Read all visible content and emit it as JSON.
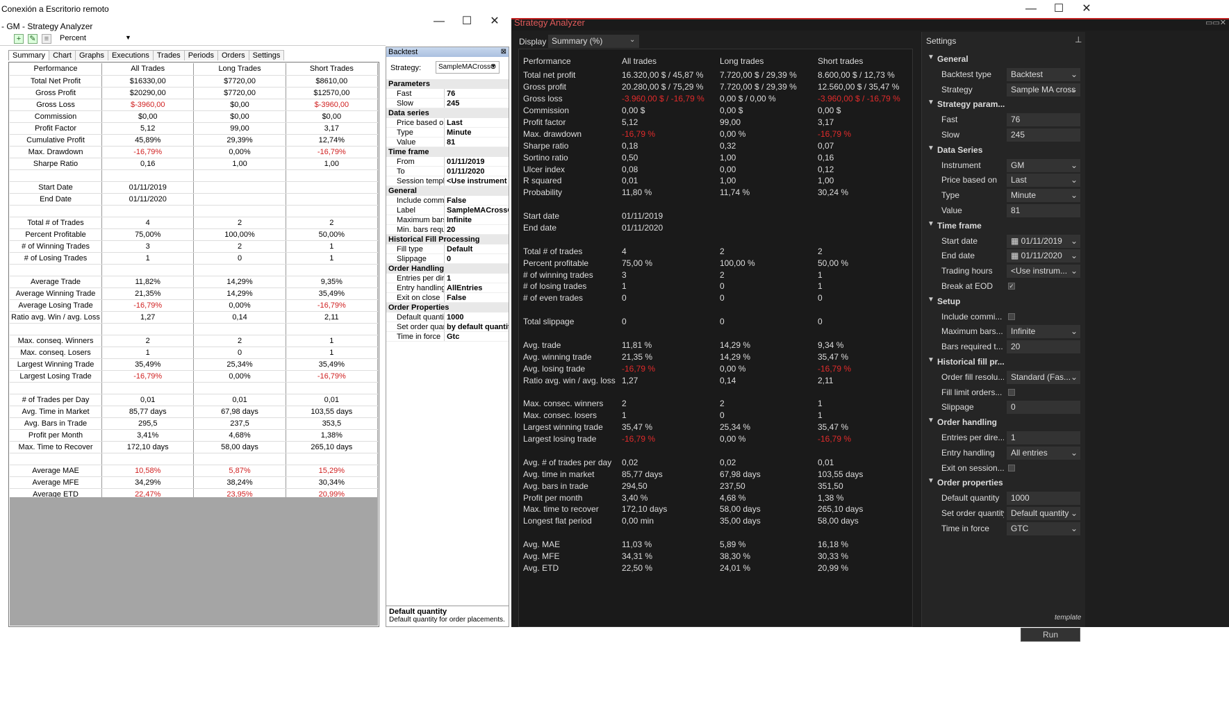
{
  "rd": {
    "title": "Conexión a Escritorio remoto",
    "old_title": "- GM - Strategy Analyzer",
    "min": "—",
    "max": "☐",
    "close": "✕"
  },
  "toolbar": {
    "mode": "Percent"
  },
  "tabs": [
    "Summary",
    "Chart",
    "Graphs",
    "Executions",
    "Trades",
    "Periods",
    "Orders",
    "Settings"
  ],
  "left_table": [
    [
      "Performance",
      "All Trades",
      "Long Trades",
      "Short Trades"
    ],
    [
      "Total Net Profit",
      "$16330,00",
      "$7720,00",
      "$8610,00"
    ],
    [
      "Gross Profit",
      "$20290,00",
      "$7720,00",
      "$12570,00"
    ],
    [
      "Gross Loss",
      "$-3960,00",
      "$0,00",
      "$-3960,00"
    ],
    [
      "Commission",
      "$0,00",
      "$0,00",
      "$0,00"
    ],
    [
      "Profit Factor",
      "5,12",
      "99,00",
      "3,17"
    ],
    [
      "Cumulative Profit",
      "45,89%",
      "29,39%",
      "12,74%"
    ],
    [
      "Max. Drawdown",
      "-16,79%",
      "0,00%",
      "-16,79%"
    ],
    [
      "Sharpe Ratio",
      "0,16",
      "1,00",
      "1,00"
    ],
    [
      "",
      "",
      "",
      ""
    ],
    [
      "Start Date",
      "01/11/2019",
      "",
      ""
    ],
    [
      "End Date",
      "01/11/2020",
      "",
      ""
    ],
    [
      "",
      "",
      "",
      ""
    ],
    [
      "Total # of Trades",
      "4",
      "2",
      "2"
    ],
    [
      "Percent Profitable",
      "75,00%",
      "100,00%",
      "50,00%"
    ],
    [
      "# of Winning Trades",
      "3",
      "2",
      "1"
    ],
    [
      "# of Losing Trades",
      "1",
      "0",
      "1"
    ],
    [
      "",
      "",
      "",
      ""
    ],
    [
      "Average Trade",
      "11,82%",
      "14,29%",
      "9,35%"
    ],
    [
      "Average Winning Trade",
      "21,35%",
      "14,29%",
      "35,49%"
    ],
    [
      "Average Losing Trade",
      "-16,79%",
      "0,00%",
      "-16,79%"
    ],
    [
      "Ratio avg. Win / avg. Loss",
      "1,27",
      "0,14",
      "2,11"
    ],
    [
      "",
      "",
      "",
      ""
    ],
    [
      "Max. conseq. Winners",
      "2",
      "2",
      "1"
    ],
    [
      "Max. conseq. Losers",
      "1",
      "0",
      "1"
    ],
    [
      "Largest Winning Trade",
      "35,49%",
      "25,34%",
      "35,49%"
    ],
    [
      "Largest Losing Trade",
      "-16,79%",
      "0,00%",
      "-16,79%"
    ],
    [
      "",
      "",
      "",
      ""
    ],
    [
      "# of Trades per Day",
      "0,01",
      "0,01",
      "0,01"
    ],
    [
      "Avg. Time in Market",
      "85,77 days",
      "67,98 days",
      "103,55 days"
    ],
    [
      "Avg. Bars in Trade",
      "295,5",
      "237,5",
      "353,5"
    ],
    [
      "Profit per Month",
      "3,41%",
      "4,68%",
      "1,38%"
    ],
    [
      "Max. Time to Recover",
      "172,10 days",
      "58,00 days",
      "265,10 days"
    ],
    [
      "",
      "",
      "",
      ""
    ],
    [
      "Average MAE",
      "10,58%",
      "5,87%",
      "15,29%"
    ],
    [
      "Average MFE",
      "34,29%",
      "38,24%",
      "30,34%"
    ],
    [
      "Average ETD",
      "22,47%",
      "23,95%",
      "20,99%"
    ]
  ],
  "backtest": {
    "title": "Backtest",
    "strategy_label": "Strategy:",
    "strategy": "SampleMACrossO",
    "sections": [
      {
        "name": "Parameters",
        "rows": [
          [
            "Fast",
            "76"
          ],
          [
            "Slow",
            "245"
          ]
        ]
      },
      {
        "name": "Data series",
        "rows": [
          [
            "Price based on",
            "Last"
          ],
          [
            "Type",
            "Minute"
          ],
          [
            "Value",
            "81"
          ]
        ]
      },
      {
        "name": "Time frame",
        "rows": [
          [
            "From",
            "01/11/2019"
          ],
          [
            "To",
            "01/11/2020"
          ],
          [
            "Session templa",
            "<Use instrument se"
          ]
        ]
      },
      {
        "name": "General",
        "rows": [
          [
            "Include commis",
            "False"
          ],
          [
            "Label",
            "SampleMACrossOv"
          ],
          [
            "Maximum bars",
            "Infinite"
          ],
          [
            "Min. bars requi",
            "20"
          ]
        ]
      },
      {
        "name": "Historical Fill Processing",
        "rows": [
          [
            "Fill type",
            "Default"
          ],
          [
            "Slippage",
            "0"
          ]
        ]
      },
      {
        "name": "Order Handling",
        "rows": [
          [
            "Entries per dire",
            "1"
          ],
          [
            "Entry handling",
            "AllEntries"
          ],
          [
            "Exit on close",
            "False"
          ]
        ]
      },
      {
        "name": "Order Properties",
        "rows": [
          [
            "Default quantity",
            "1000"
          ],
          [
            "Set order quant",
            "by default quantity"
          ],
          [
            "Time in force",
            "Gtc"
          ]
        ]
      }
    ],
    "help_title": "Default quantity",
    "help_text": "Default quantity for order placements."
  },
  "dark": {
    "title": "Strategy Analyzer",
    "display_label": "Display",
    "display_value": "Summary (%)",
    "headers": [
      "Performance",
      "All trades",
      "Long trades",
      "Short trades"
    ],
    "rows": [
      [
        "Total net profit",
        "16.320,00 $ / 45,87 %",
        "7.720,00 $ / 29,39 %",
        "8.600,00 $ / 12,73 %"
      ],
      [
        "Gross profit",
        "20.280,00 $ / 75,29 %",
        "7.720,00 $ / 29,39 %",
        "12.560,00 $ / 35,47 %"
      ],
      [
        "Gross loss",
        "-3.960,00 $ / -16,79 %",
        "0,00 $ / 0,00 %",
        "-3.960,00 $ / -16,79 %"
      ],
      [
        "Commission",
        "0,00 $",
        "0,00 $",
        "0,00 $"
      ],
      [
        "Profit factor",
        "5,12",
        "99,00",
        "3,17"
      ],
      [
        "Max. drawdown",
        "-16,79 %",
        "0,00 %",
        "-16,79 %"
      ],
      [
        "Sharpe ratio",
        "0,18",
        "0,32",
        "0,07"
      ],
      [
        "Sortino ratio",
        "0,50",
        "1,00",
        "0,16"
      ],
      [
        "Ulcer index",
        "0,08",
        "0,00",
        "0,12"
      ],
      [
        "R squared",
        "0,01",
        "1,00",
        "1,00"
      ],
      [
        "Probability",
        "11,80 %",
        "11,74 %",
        "30,24 %"
      ],
      [
        "",
        "",
        "",
        ""
      ],
      [
        "Start date",
        "01/11/2019",
        "",
        ""
      ],
      [
        "End date",
        "01/11/2020",
        "",
        ""
      ],
      [
        "",
        "",
        "",
        ""
      ],
      [
        "Total # of trades",
        "4",
        "2",
        "2"
      ],
      [
        "Percent profitable",
        "75,00 %",
        "100,00 %",
        "50,00 %"
      ],
      [
        "# of winning trades",
        "3",
        "2",
        "1"
      ],
      [
        "# of losing trades",
        "1",
        "0",
        "1"
      ],
      [
        "# of even trades",
        "0",
        "0",
        "0"
      ],
      [
        "",
        "",
        "",
        ""
      ],
      [
        "Total slippage",
        "0",
        "0",
        "0"
      ],
      [
        "",
        "",
        "",
        ""
      ],
      [
        "Avg. trade",
        "11,81 %",
        "14,29 %",
        "9,34 %"
      ],
      [
        "Avg. winning trade",
        "21,35 %",
        "14,29 %",
        "35,47 %"
      ],
      [
        "Avg. losing trade",
        "-16,79 %",
        "0,00 %",
        "-16,79 %"
      ],
      [
        "Ratio avg. win / avg. loss",
        "1,27",
        "0,14",
        "2,11"
      ],
      [
        "",
        "",
        "",
        ""
      ],
      [
        "Max. consec. winners",
        "2",
        "2",
        "1"
      ],
      [
        "Max. consec. losers",
        "1",
        "0",
        "1"
      ],
      [
        "Largest winning trade",
        "35,47 %",
        "25,34 %",
        "35,47 %"
      ],
      [
        "Largest losing trade",
        "-16,79 %",
        "0,00 %",
        "-16,79 %"
      ],
      [
        "",
        "",
        "",
        ""
      ],
      [
        "Avg. # of trades per day",
        "0,02",
        "0,02",
        "0,01"
      ],
      [
        "Avg. time in market",
        "85,77 days",
        "67,98 days",
        "103,55 days"
      ],
      [
        "Avg. bars in trade",
        "294,50",
        "237,50",
        "351,50"
      ],
      [
        "Profit per month",
        "3,40 %",
        "4,68 %",
        "1,38 %"
      ],
      [
        "Max. time to recover",
        "172,10 days",
        "58,00 days",
        "265,10 days"
      ],
      [
        "Longest flat period",
        "0,00 min",
        "35,00 days",
        "58,00 days"
      ],
      [
        "",
        "",
        "",
        ""
      ],
      [
        "Avg. MAE",
        "11,03 %",
        "5,89 %",
        "16,18 %"
      ],
      [
        "Avg. MFE",
        "34,31 %",
        "38,30 %",
        "30,33 %"
      ],
      [
        "Avg. ETD",
        "22,50 %",
        "24,01 %",
        "20,99 %"
      ]
    ]
  },
  "settings": {
    "title": "Settings",
    "template": "template",
    "run": "Run",
    "items": [
      {
        "kind": "cat",
        "label": "General"
      },
      {
        "kind": "sel",
        "label": "Backtest type",
        "value": "Backtest"
      },
      {
        "kind": "sel",
        "label": "Strategy",
        "value": "Sample MA cross"
      },
      {
        "kind": "cat",
        "label": "Strategy param..."
      },
      {
        "kind": "txt",
        "label": "Fast",
        "value": "76"
      },
      {
        "kind": "txt",
        "label": "Slow",
        "value": "245"
      },
      {
        "kind": "cat",
        "label": "Data Series"
      },
      {
        "kind": "sel",
        "label": "Instrument",
        "value": "GM"
      },
      {
        "kind": "sel",
        "label": "Price based on",
        "value": "Last"
      },
      {
        "kind": "sel",
        "label": "Type",
        "value": "Minute"
      },
      {
        "kind": "txt",
        "label": "Value",
        "value": "81"
      },
      {
        "kind": "cat",
        "label": "Time frame"
      },
      {
        "kind": "sel",
        "label": "Start date",
        "value": "▦ 01/11/2019"
      },
      {
        "kind": "sel",
        "label": "End date",
        "value": "▦ 01/11/2020"
      },
      {
        "kind": "sel",
        "label": "Trading hours",
        "value": "<Use instrum..."
      },
      {
        "kind": "chk",
        "label": "Break at EOD",
        "value": "✓"
      },
      {
        "kind": "cat",
        "label": "Setup"
      },
      {
        "kind": "chk",
        "label": "Include commi...",
        "value": ""
      },
      {
        "kind": "sel",
        "label": "Maximum bars...",
        "value": "Infinite"
      },
      {
        "kind": "txt",
        "label": "Bars required t...",
        "value": "20"
      },
      {
        "kind": "cat",
        "label": "Historical fill pr..."
      },
      {
        "kind": "sel",
        "label": "Order fill resolu...",
        "value": "Standard (Fas..."
      },
      {
        "kind": "chk",
        "label": "Fill limit orders...",
        "value": ""
      },
      {
        "kind": "txt",
        "label": "Slippage",
        "value": "0"
      },
      {
        "kind": "cat",
        "label": "Order handling"
      },
      {
        "kind": "txt",
        "label": "Entries per dire...",
        "value": "1"
      },
      {
        "kind": "sel",
        "label": "Entry handling",
        "value": "All entries"
      },
      {
        "kind": "chk",
        "label": "Exit on session...",
        "value": ""
      },
      {
        "kind": "cat",
        "label": "Order properties"
      },
      {
        "kind": "txt",
        "label": "Default quantity",
        "value": "1000"
      },
      {
        "kind": "sel",
        "label": "Set order quantity",
        "value": "Default quantity"
      },
      {
        "kind": "sel",
        "label": "Time in force",
        "value": "GTC"
      }
    ]
  }
}
